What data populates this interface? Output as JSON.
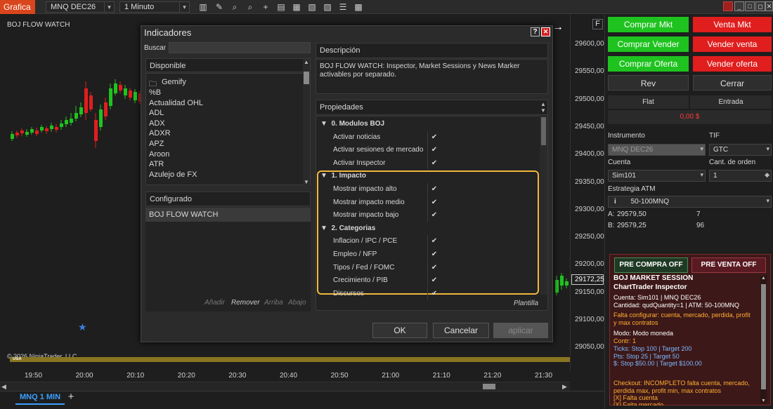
{
  "toolbar": {
    "app_title": "Grafica",
    "instrument": "MNQ DEC26",
    "interval": "1 Minuto",
    "icons": [
      "bars-icon",
      "pencil-icon",
      "zoom-icon",
      "zoom-out-icon",
      "crosshair-icon",
      "properties-icon",
      "data-box-icon",
      "chart-trader-icon",
      "strategy-icon",
      "list-icon"
    ],
    "window_buttons": [
      "_",
      "□",
      "◻",
      "X"
    ]
  },
  "chart": {
    "indicator_label": "BOJ FLOW WATCH",
    "copyright": "© 2026 NinjaTrader, LLC",
    "session_label": "USA",
    "current_price": "29172,25",
    "price_ticks": [
      "29600,00",
      "29550,00",
      "29500,00",
      "29450,00",
      "29400,00",
      "29350,00",
      "29300,00",
      "29250,00",
      "29200,00",
      "29150,00",
      "29100,00",
      "29050,00"
    ],
    "time_ticks": [
      "19:50",
      "20:00",
      "20:10",
      "20:20",
      "20:30",
      "20:40",
      "20:50",
      "21:00",
      "21:10",
      "21:20",
      "21:30"
    ],
    "tab_label": "MNQ 1 MIN",
    "add_tab": "+",
    "f_button": "F",
    "colors": {
      "up": "#1fc31f",
      "down": "#e01e1e",
      "session_bar": "#8a7520"
    }
  },
  "dialog": {
    "title": "Indicadores",
    "help": "?",
    "close": "✕",
    "search_label": "Buscar",
    "search_value": "",
    "available_header": "Disponible",
    "available_items": [
      "Gemify",
      "%B",
      "Actualidad OHL",
      "ADL",
      "ADX",
      "ADXR",
      "APZ",
      "Aroon",
      "ATR",
      "Azulejo de FX"
    ],
    "configured_header": "Configurado",
    "configured_items": [
      "BOJ FLOW WATCH"
    ],
    "list_actions": {
      "add": "Añadir",
      "remove": "Remover",
      "up": "Arriba",
      "down": "Abajo"
    },
    "description_header": "Descripción",
    "description_text": "BOJ FLOW WATCH: Inspector, Market Sessions y News Marker activables por separado.",
    "properties_header": "Propiedades",
    "groups": [
      {
        "name": "0. Modulos BOJ",
        "rows": [
          "Activar noticias",
          "Activar sesiones de mercado",
          "Activar Inspector"
        ]
      },
      {
        "name": "1. Impacto",
        "rows": [
          "Mostrar impacto alto",
          "Mostrar impacto medio",
          "Mostrar impacto bajo"
        ]
      },
      {
        "name": "2. Categorias",
        "rows": [
          "Inflacion / IPC / PCE",
          "Empleo / NFP",
          "Tipos / Fed / FOMC",
          "Crecimiento / PIB",
          "Discursos"
        ]
      }
    ],
    "template_label": "Plantilla",
    "ok": "OK",
    "cancel": "Cancelar",
    "apply": "aplicar"
  },
  "trader": {
    "buy_mkt": "Comprar Mkt",
    "sell_mkt": "Venta Mkt",
    "buy_bid": "Comprar Vender",
    "sell_ask": "Vender venta",
    "buy_offer": "Comprar Oferta",
    "sell_offer": "Vender oferta",
    "rev": "Rev",
    "close": "Cerrar",
    "flat": "Flat",
    "entry": "Entrada",
    "pnl": "0,00 $",
    "instrument_label": "Instrumento",
    "instrument_value": "MNQ DEC26",
    "tif_label": "TIF",
    "tif_value": "GTC",
    "account_label": "Cuenta",
    "account_value": "Sim101",
    "qty_label": "Cant. de orden",
    "qty_value": "1",
    "atm_label": "Estrategia ATM",
    "atm_value": "50-100MNQ",
    "atm_info": "i",
    "ask_label": "A:",
    "ask_price": "29579,50",
    "ask_size": "7",
    "bid_label": "B:",
    "bid_price": "29579,25",
    "bid_size": "96"
  },
  "inspector": {
    "pre_buy": "PRE COMPRA OFF",
    "pre_sell": "PRE VENTA OFF",
    "title": "BOJ MARKET SESSION",
    "subtitle": "ChartTrader Inspector",
    "line1": "Cuenta: Sim101 | MNQ DEC26",
    "line2": "Cantidad: qudQuantity=1 | ATM: 50-100MNQ",
    "warn1": "Falta configurar: cuenta, mercado, perdida, profit",
    "warn2": "y max contratos",
    "mode": "Modo: Modo moneda",
    "contr": "Contr: 1",
    "ticks": "Ticks: Stop 100 | Target 200",
    "pts": "Pts: Stop 25 | Target 50",
    "usd": "$: Stop $50.00 | Target $100.00",
    "checkout1": "Checkout: INCOMPLETO falta cuenta, mercado,",
    "checkout2": "perdida max, profit min, max contratos",
    "missing1": "[X] Falta cuenta",
    "missing2": "[X] Falta mercado"
  }
}
